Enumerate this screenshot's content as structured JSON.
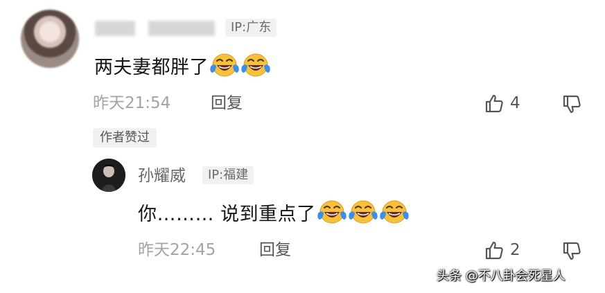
{
  "comment": {
    "ip_label": "IP:广东",
    "text": "两夫妻都胖了",
    "emoji_count": 2,
    "time": "昨天21:54",
    "reply_label": "回复",
    "like_count": "4",
    "author_liked_label": "作者赞过"
  },
  "reply": {
    "user_name": "孙耀威",
    "ip_label": "IP:福建",
    "text": "你……… 说到重点了",
    "emoji_count": 3,
    "time": "昨天22:45",
    "reply_label": "回复",
    "like_count": "2"
  },
  "watermark": "头条 @不八卦会死星人",
  "icons": [
    "thumbs-up-icon",
    "thumbs-down-icon",
    "laughing-crying-emoji"
  ],
  "colors": {
    "ip_tag_bg": "#f1f1f1",
    "meta_text": "#a3a3a3",
    "emoji_yellow": "#f7c23a",
    "tear_blue": "#3a8ef0"
  }
}
